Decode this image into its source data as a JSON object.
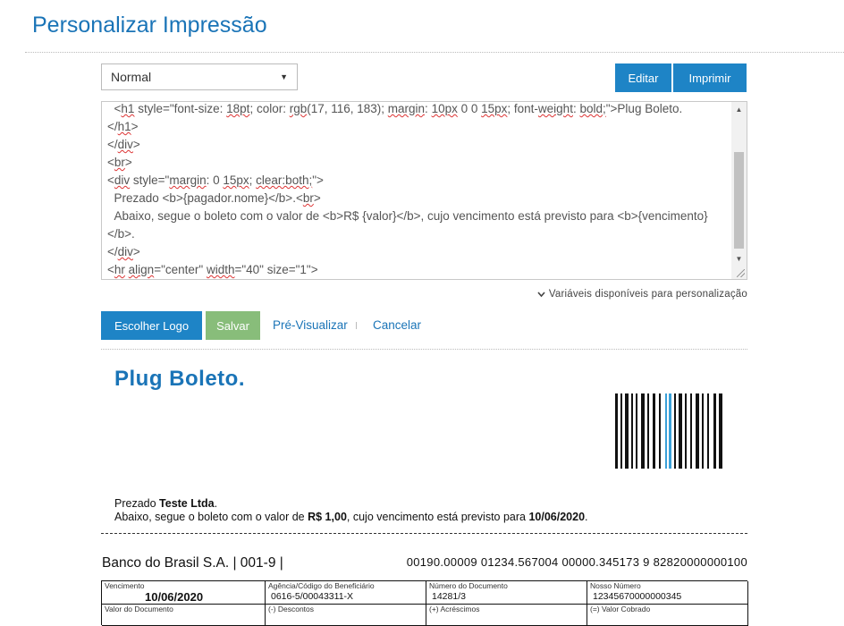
{
  "page": {
    "title": "Personalizar Impressão"
  },
  "toolbar": {
    "template_selected": "Normal",
    "edit_label": "Editar",
    "print_label": "Imprimir"
  },
  "editor": {
    "lines": [
      [
        "  <",
        [
          "h1"
        ],
        " style=\"font-size: ",
        [
          "18pt"
        ],
        "; color: ",
        [
          "rgb"
        ],
        "(17, 116, 183); ",
        [
          "margin"
        ],
        ": ",
        [
          "10px"
        ],
        " 0 0 ",
        [
          "15px"
        ],
        "; font-",
        [
          "weight"
        ],
        ": ",
        [
          "bold;"
        ],
        "\">Plug Boleto."
      ],
      [
        "</",
        [
          "h1"
        ],
        ">"
      ],
      [
        "</",
        [
          "div"
        ],
        ">"
      ],
      [
        "<",
        [
          "br"
        ],
        ">"
      ],
      [
        "<",
        [
          "div"
        ],
        " style=\"",
        [
          "margin"
        ],
        ": 0 ",
        [
          "15px"
        ],
        "; ",
        [
          "clear:both;"
        ],
        "\">"
      ],
      [
        "  Prezado <b>{pagador.nome}</b>.<",
        [
          "br"
        ],
        ">"
      ],
      [
        "  Abaixo, segue o boleto com o valor de <b>R$ {valor}</b>, cujo vencimento está previsto para <b>{vencimento}</b>."
      ],
      [
        "</",
        [
          "div"
        ],
        ">"
      ],
      [
        "<",
        [
          "hr"
        ],
        " ",
        [
          "align"
        ],
        "=\"center\" ",
        [
          "width"
        ],
        "=\"40\" size=\"1\">"
      ]
    ]
  },
  "variables_toggle": "Variáveis disponíveis para personalização",
  "actions": {
    "choose_logo": "Escolher Logo",
    "save": "Salvar",
    "preview": "Pré-Visualizar",
    "cancel": "Cancelar"
  },
  "preview": {
    "title": "Plug Boleto.",
    "greeting_prefix": "Prezado ",
    "payer_name": "Teste Ltda",
    "greeting_suffix": ".",
    "body_prefix": "Abaixo, segue o boleto com o valor de ",
    "amount": "R$ 1,00",
    "body_middle": ", cujo vencimento está previsto para ",
    "due_date": "10/06/2020",
    "body_suffix": "."
  },
  "slip": {
    "bank_name": "Banco do Brasil S.A. | 001-9 |",
    "digitable_line": "00190.00009 01234.567004 00000.345173 9 82820000000100",
    "row1": [
      {
        "label": "Vencimento",
        "value": "10/06/2020"
      },
      {
        "label": "Agência/Código do Beneficiário",
        "value": "0616-5/00043311-X"
      },
      {
        "label": "Número do Documento",
        "value": "14281/3"
      },
      {
        "label": "Nosso Número",
        "value": "12345670000000345"
      }
    ],
    "row2": [
      {
        "label": "Valor do Documento"
      },
      {
        "label": "(-) Descontos"
      },
      {
        "label": "(+) Acréscimos"
      },
      {
        "label": "(=) Valor Cobrado"
      }
    ]
  },
  "colors": {
    "brand_blue": "#1e84c6",
    "title_blue": "#1a74b7",
    "save_green": "#88bd7a",
    "barcode_accent": "#3aa0d8"
  }
}
